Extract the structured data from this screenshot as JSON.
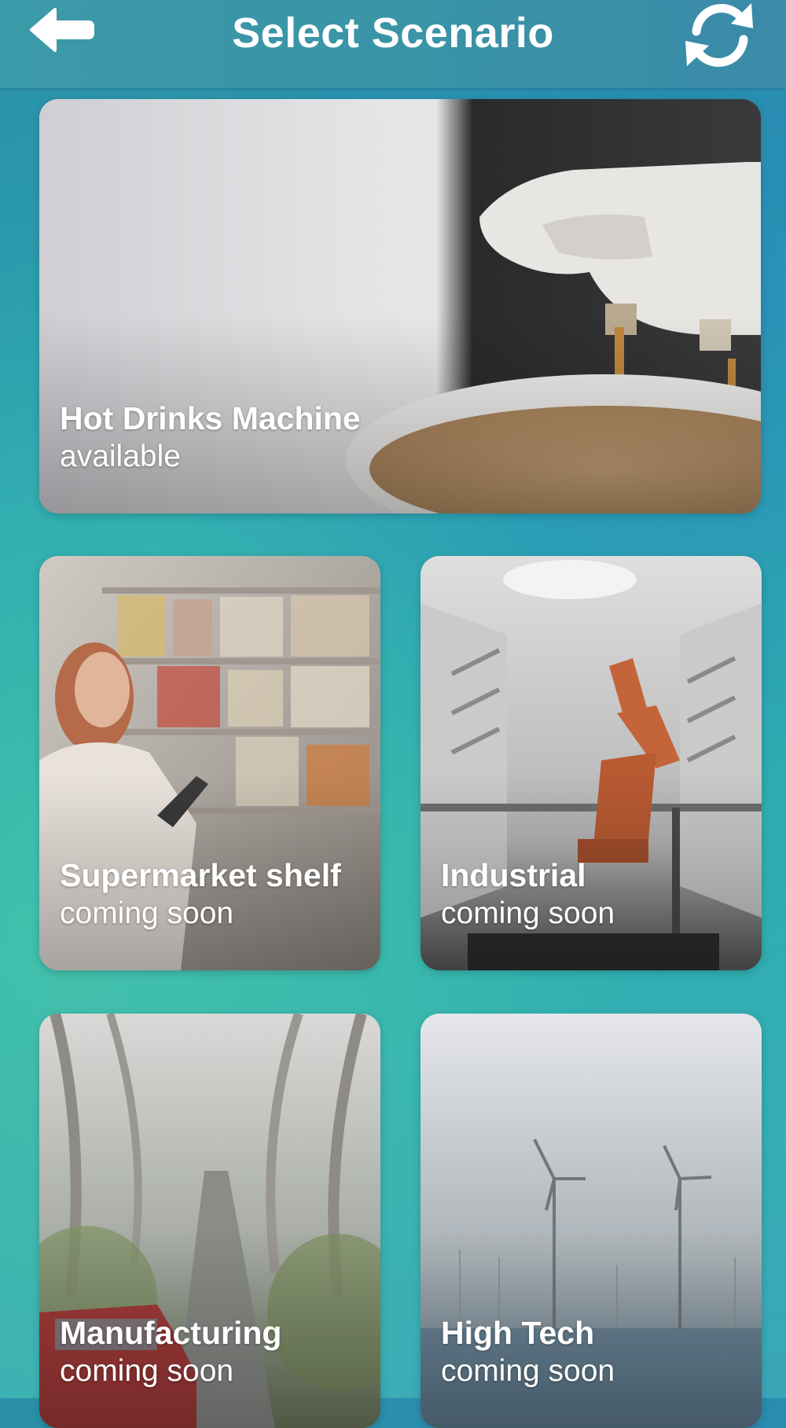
{
  "header": {
    "title": "Select Scenario",
    "back_icon": "arrow-left-icon",
    "refresh_icon": "refresh-icon"
  },
  "scenarios": [
    {
      "title": "Hot Drinks Machine",
      "status": "available"
    },
    {
      "title": "Supermarket shelf",
      "status": "coming soon"
    },
    {
      "title": "Industrial",
      "status": "coming soon"
    },
    {
      "title": "Manufacturing",
      "status": "coming soon"
    },
    {
      "title": "High Tech",
      "status": "coming soon"
    }
  ],
  "colors": {
    "header_bg": "#3a94a6",
    "text": "#ffffff",
    "background_teal": "#2fb8ad",
    "background_blue": "#2a8fa8"
  }
}
